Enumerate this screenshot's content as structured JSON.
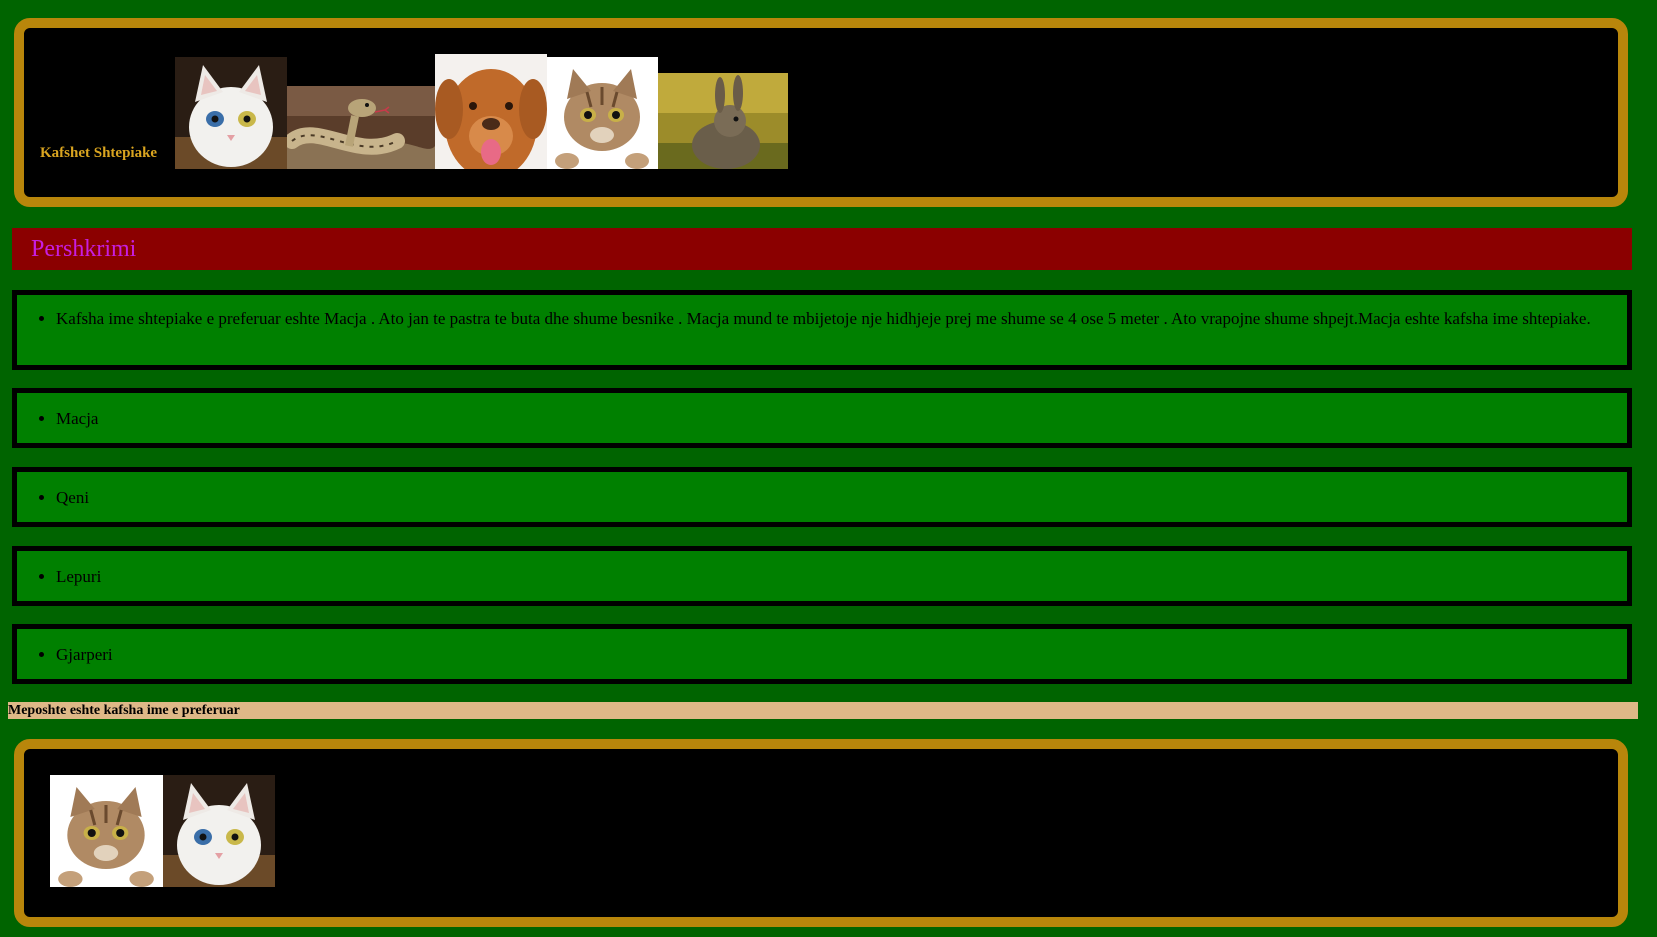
{
  "header": {
    "title": "Kafshet Shtepiake",
    "images": [
      "white-cat-photo",
      "snake-photo",
      "dog-photo",
      "tabby-cat-photo",
      "rabbit-photo"
    ]
  },
  "description_heading": "Pershkrimi",
  "description_text": "Kafsha ime shtepiake e preferuar eshte Macja . Ato jan te pastra te buta dhe shume besnike . Macja mund te mbijetoje nje hidhjeje prej me shume se 4 ose 5 meter . Ato vrapojne shume shpejt.Macja eshte kafsha ime shtepiake.",
  "animal_list": [
    "Macja",
    "Qeni",
    "Lepuri",
    "Gjarperi"
  ],
  "favorite_note": "Meposhte eshte kafsha ime e preferuar",
  "footer": {
    "images": [
      "tabby-cat-photo",
      "white-cat-photo"
    ]
  },
  "colors": {
    "page_background": "#006400",
    "frame_border": "#b8860b",
    "frame_fill": "#000000",
    "title_text": "#daa520",
    "description_bar": "#8b0000",
    "description_heading": "#c71ee0",
    "list_box": "#008000",
    "note_bar": "#deb887"
  }
}
